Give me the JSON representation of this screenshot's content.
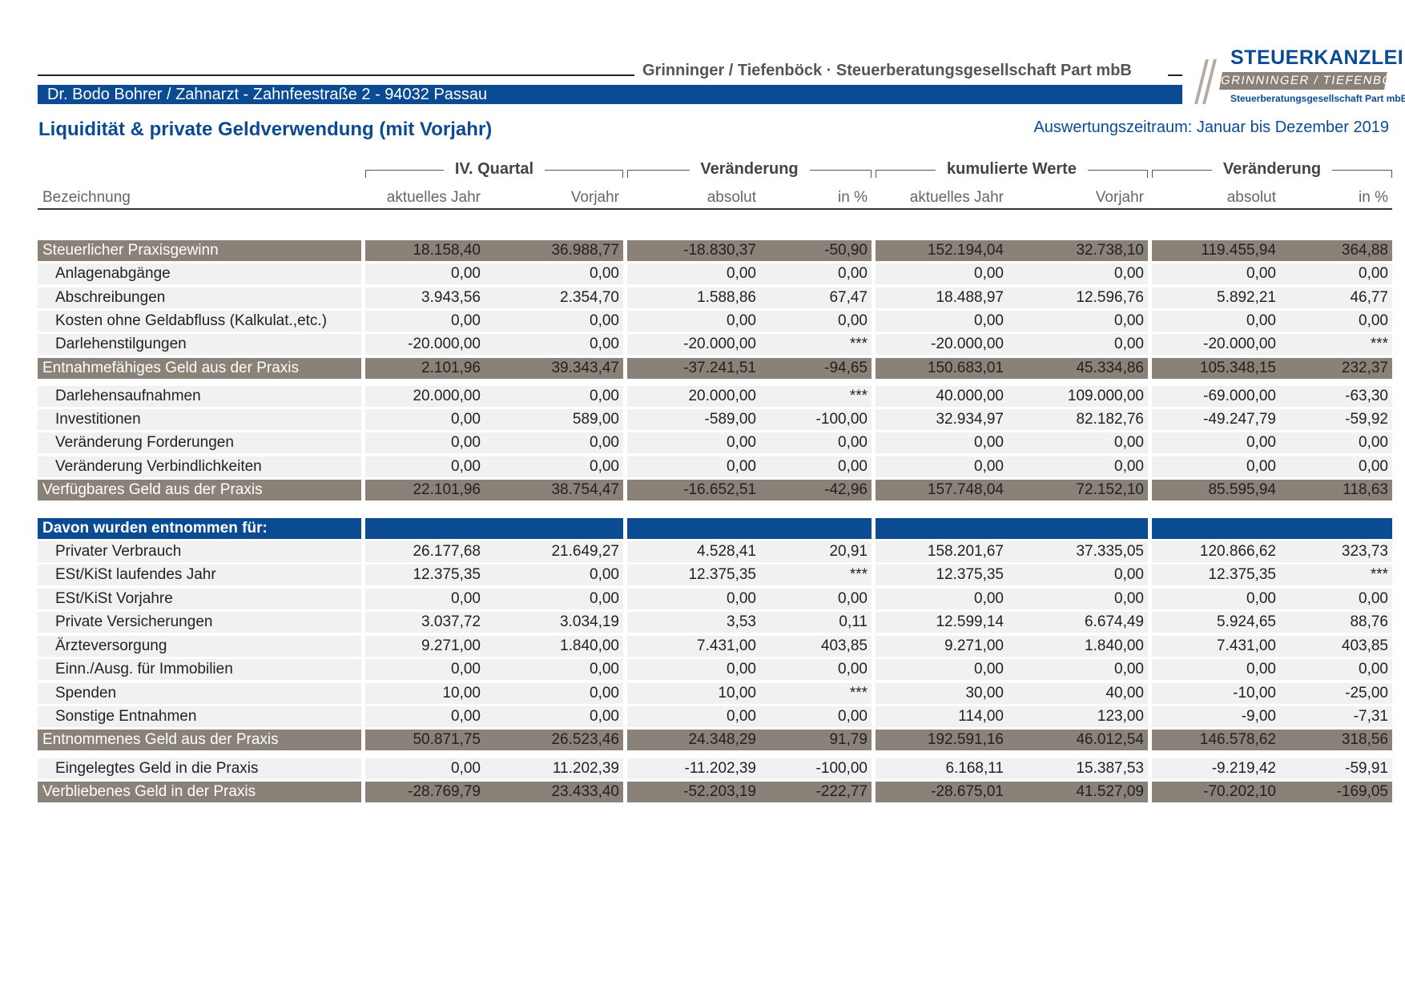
{
  "header": {
    "firm_line": "Grinninger / Tiefenböck · Steuerberatungsgesellschaft Part mbB",
    "client_line": "Dr. Bodo Bohrer / Zahnarzt  -  Zahnfeestraße 2  -  94032 Passau",
    "title": "Liquidität & private Geldverwendung (mit Vorjahr)",
    "period": "Auswertungszeitraum: Januar bis Dezember 2019"
  },
  "logo": {
    "line1": "STEUERKANZLEI",
    "line2": "GRINNINGER / TIEFENBÖCK",
    "line3": "Steuerberatungsgesellschaft Part mbB"
  },
  "groups": [
    "IV. Quartal",
    "Veränderung",
    "kumulierte Werte",
    "Veränderung"
  ],
  "columns": [
    "Bezeichnung",
    "aktuelles Jahr",
    "Vorjahr",
    "absolut",
    "in %",
    "aktuelles Jahr",
    "Vorjahr",
    "absolut",
    "in %"
  ],
  "rows": [
    {
      "type": "total",
      "label": "Steuerlicher Praxisgewinn",
      "values": [
        "18.158,40",
        "36.988,77",
        "-18.830,37",
        "-50,90",
        "152.194,04",
        "32.738,10",
        "119.455,94",
        "364,88"
      ]
    },
    {
      "type": "item",
      "label": "Anlagenabgänge",
      "values": [
        "0,00",
        "0,00",
        "0,00",
        "0,00",
        "0,00",
        "0,00",
        "0,00",
        "0,00"
      ]
    },
    {
      "type": "item",
      "label": "Abschreibungen",
      "values": [
        "3.943,56",
        "2.354,70",
        "1.588,86",
        "67,47",
        "18.488,97",
        "12.596,76",
        "5.892,21",
        "46,77"
      ]
    },
    {
      "type": "item",
      "label": "Kosten ohne Geldabfluss (Kalkulat.,etc.)",
      "values": [
        "0,00",
        "0,00",
        "0,00",
        "0,00",
        "0,00",
        "0,00",
        "0,00",
        "0,00"
      ]
    },
    {
      "type": "item",
      "label": "Darlehenstilgungen",
      "values": [
        "-20.000,00",
        "0,00",
        "-20.000,00",
        "***",
        "-20.000,00",
        "0,00",
        "-20.000,00",
        "***"
      ]
    },
    {
      "type": "total",
      "label": "Entnahmefähiges Geld aus der Praxis",
      "values": [
        "2.101,96",
        "39.343,47",
        "-37.241,51",
        "-94,65",
        "150.683,01",
        "45.334,86",
        "105.348,15",
        "232,37"
      ]
    },
    {
      "type": "item",
      "label": "Darlehensaufnahmen",
      "values": [
        "20.000,00",
        "0,00",
        "20.000,00",
        "***",
        "40.000,00",
        "109.000,00",
        "-69.000,00",
        "-63,30"
      ]
    },
    {
      "type": "item",
      "label": "Investitionen",
      "values": [
        "0,00",
        "589,00",
        "-589,00",
        "-100,00",
        "32.934,97",
        "82.182,76",
        "-49.247,79",
        "-59,92"
      ]
    },
    {
      "type": "item",
      "label": "Veränderung Forderungen",
      "values": [
        "0,00",
        "0,00",
        "0,00",
        "0,00",
        "0,00",
        "0,00",
        "0,00",
        "0,00"
      ]
    },
    {
      "type": "item",
      "label": "Veränderung Verbindlichkeiten",
      "values": [
        "0,00",
        "0,00",
        "0,00",
        "0,00",
        "0,00",
        "0,00",
        "0,00",
        "0,00"
      ]
    },
    {
      "type": "total",
      "label": "Verfügbares Geld aus der Praxis",
      "values": [
        "22.101,96",
        "38.754,47",
        "-16.652,51",
        "-42,96",
        "157.748,04",
        "72.152,10",
        "85.595,94",
        "118,63"
      ]
    },
    {
      "type": "section",
      "label": "Davon wurden entnommen für:",
      "values": [
        "",
        "",
        "",
        "",
        "",
        "",
        "",
        ""
      ]
    },
    {
      "type": "item",
      "label": "Privater Verbrauch",
      "values": [
        "26.177,68",
        "21.649,27",
        "4.528,41",
        "20,91",
        "158.201,67",
        "37.335,05",
        "120.866,62",
        "323,73"
      ]
    },
    {
      "type": "item",
      "label": "ESt/KiSt laufendes Jahr",
      "values": [
        "12.375,35",
        "0,00",
        "12.375,35",
        "***",
        "12.375,35",
        "0,00",
        "12.375,35",
        "***"
      ]
    },
    {
      "type": "item",
      "label": "ESt/KiSt Vorjahre",
      "values": [
        "0,00",
        "0,00",
        "0,00",
        "0,00",
        "0,00",
        "0,00",
        "0,00",
        "0,00"
      ]
    },
    {
      "type": "item",
      "label": "Private Versicherungen",
      "values": [
        "3.037,72",
        "3.034,19",
        "3,53",
        "0,11",
        "12.599,14",
        "6.674,49",
        "5.924,65",
        "88,76"
      ]
    },
    {
      "type": "item",
      "label": "Ärzteversorgung",
      "values": [
        "9.271,00",
        "1.840,00",
        "7.431,00",
        "403,85",
        "9.271,00",
        "1.840,00",
        "7.431,00",
        "403,85"
      ]
    },
    {
      "type": "item",
      "label": "Einn./Ausg. für Immobilien",
      "values": [
        "0,00",
        "0,00",
        "0,00",
        "0,00",
        "0,00",
        "0,00",
        "0,00",
        "0,00"
      ]
    },
    {
      "type": "item",
      "label": "Spenden",
      "values": [
        "10,00",
        "0,00",
        "10,00",
        "***",
        "30,00",
        "40,00",
        "-10,00",
        "-25,00"
      ]
    },
    {
      "type": "item",
      "label": "Sonstige Entnahmen",
      "values": [
        "0,00",
        "0,00",
        "0,00",
        "0,00",
        "114,00",
        "123,00",
        "-9,00",
        "-7,31"
      ]
    },
    {
      "type": "total",
      "label": "Entnommenes Geld aus der Praxis",
      "values": [
        "50.871,75",
        "26.523,46",
        "24.348,29",
        "91,79",
        "192.591,16",
        "46.012,54",
        "146.578,62",
        "318,56"
      ]
    },
    {
      "type": "item",
      "label": "Eingelegtes Geld in die Praxis",
      "values": [
        "0,00",
        "11.202,39",
        "-11.202,39",
        "-100,00",
        "6.168,11",
        "15.387,53",
        "-9.219,42",
        "-59,91"
      ]
    },
    {
      "type": "total",
      "label": "Verbliebenes Geld in der Praxis",
      "values": [
        "-28.769,79",
        "23.433,40",
        "-52.203,19",
        "-222,77",
        "-28.675,01",
        "41.527,09",
        "-70.202,10",
        "-169,05"
      ]
    }
  ]
}
